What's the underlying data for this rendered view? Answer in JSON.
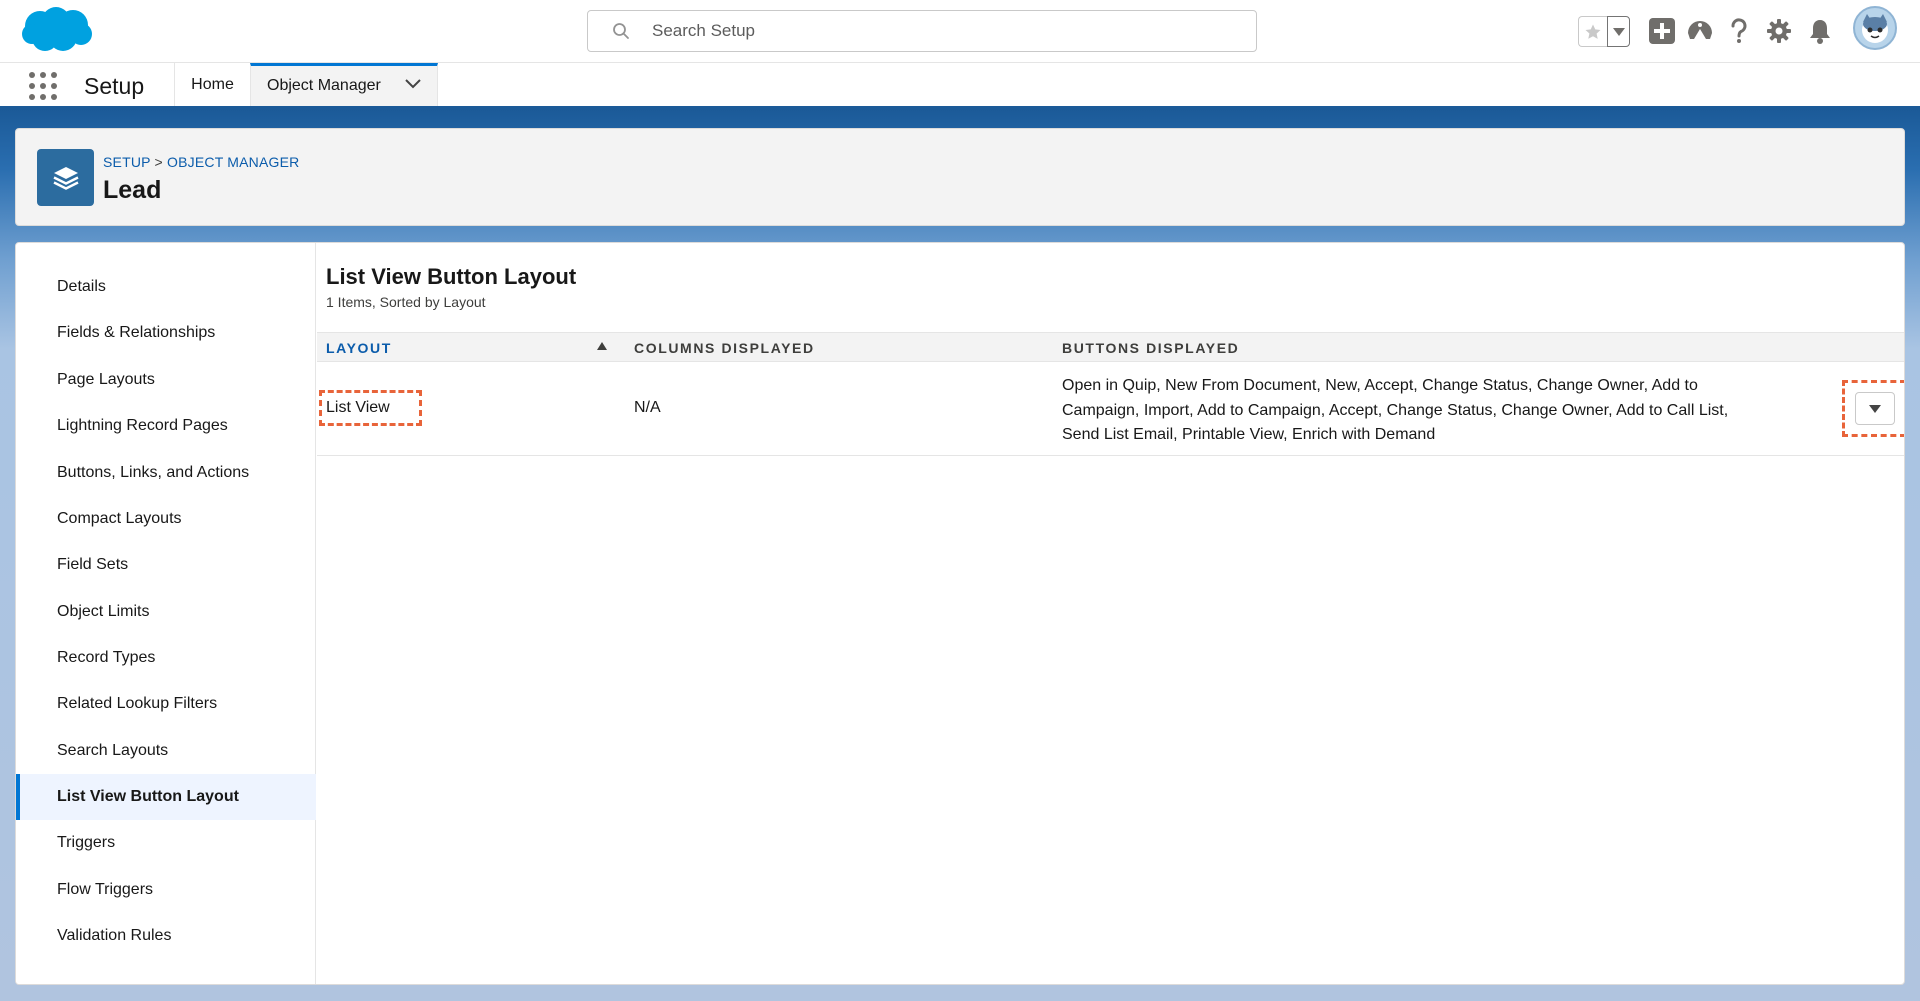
{
  "header": {
    "search_placeholder": "Search Setup"
  },
  "context_bar": {
    "app_name": "Setup",
    "tabs": [
      {
        "label": "Home"
      },
      {
        "label": "Object Manager"
      }
    ]
  },
  "object_header": {
    "breadcrumb": [
      "SETUP",
      "OBJECT MANAGER"
    ],
    "breadcrumb_sep": ">",
    "title": "Lead"
  },
  "sidebar": {
    "items": [
      {
        "label": "Details"
      },
      {
        "label": "Fields & Relationships"
      },
      {
        "label": "Page Layouts"
      },
      {
        "label": "Lightning Record Pages"
      },
      {
        "label": "Buttons, Links, and Actions"
      },
      {
        "label": "Compact Layouts"
      },
      {
        "label": "Field Sets"
      },
      {
        "label": "Object Limits"
      },
      {
        "label": "Record Types"
      },
      {
        "label": "Related Lookup Filters"
      },
      {
        "label": "Search Layouts"
      },
      {
        "label": "List View Button Layout"
      },
      {
        "label": "Triggers"
      },
      {
        "label": "Flow Triggers"
      },
      {
        "label": "Validation Rules"
      }
    ],
    "active_index": 11
  },
  "main": {
    "title": "List View Button Layout",
    "subtitle": "1 Items, Sorted by Layout",
    "columns": [
      "LAYOUT",
      "COLUMNS DISPLAYED",
      "BUTTONS DISPLAYED"
    ],
    "rows": [
      {
        "layout": "List View",
        "columns_displayed": "N/A",
        "buttons_displayed": "Open in Quip, New From Document, New, Accept, Change Status, Change Owner, Add to Campaign, Import, Add to Campaign, Accept, Change Status, Change Owner, Add to Call List, Send List Email, Printable View, Enrich with Demand"
      }
    ]
  },
  "colors": {
    "brand_blue": "#0176d3",
    "header_band": "#1b5a98",
    "object_icon": "#2c6c9f",
    "highlight_dashed": "#e8643a"
  },
  "icons": {
    "logo": "salesforce-cloud-icon",
    "search": "search-icon",
    "favorite": "star-icon",
    "global_actions": "plus-icon",
    "trailhead": "trailhead-icon",
    "help": "question-icon",
    "setup": "gear-icon",
    "notifications": "bell-icon",
    "object": "stack-layers-icon"
  }
}
